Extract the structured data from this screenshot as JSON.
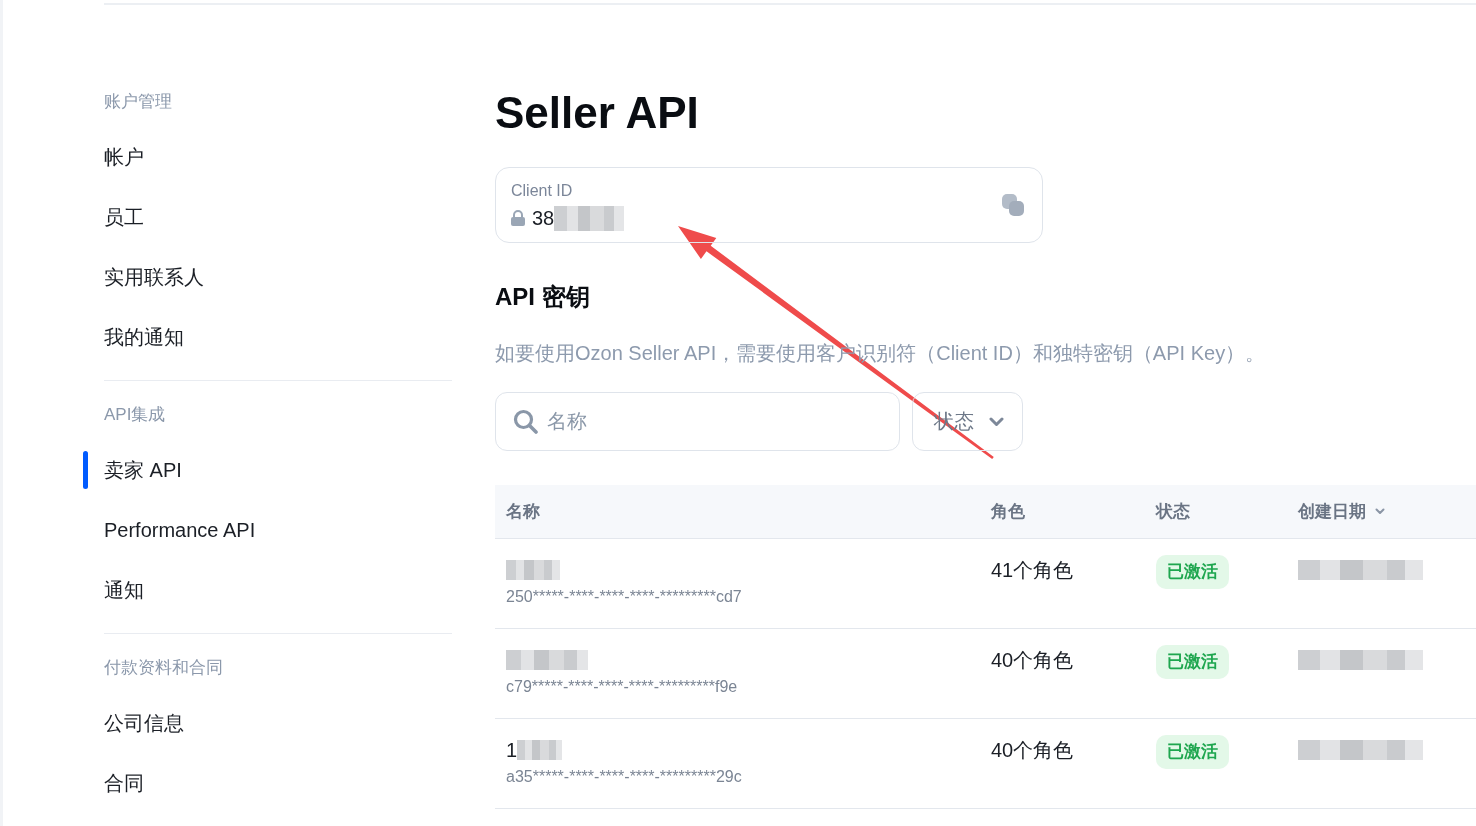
{
  "sidebar": {
    "sections": [
      {
        "title": "账户管理",
        "items": [
          {
            "label": "帐户",
            "selected": false
          },
          {
            "label": "员工",
            "selected": false
          },
          {
            "label": "实用联系人",
            "selected": false
          },
          {
            "label": "我的通知",
            "selected": false
          }
        ]
      },
      {
        "title": "API集成",
        "items": [
          {
            "label": "卖家 API",
            "selected": true
          },
          {
            "label": "Performance API",
            "selected": false
          },
          {
            "label": "通知",
            "selected": false
          }
        ]
      },
      {
        "title": "付款资料和合同",
        "items": [
          {
            "label": "公司信息",
            "selected": false
          },
          {
            "label": "合同",
            "selected": false
          }
        ]
      }
    ]
  },
  "page": {
    "title": "Seller API"
  },
  "client_id": {
    "label": "Client ID",
    "value": "38",
    "locked": true,
    "redacted": true
  },
  "api_keys": {
    "heading": "API 密钥",
    "description": "如要使用Ozon Seller API，需要使用客户识别符（Client ID）和独特密钥（API Key）。",
    "search": {
      "placeholder": "名称"
    },
    "status_filter": {
      "label": "状态"
    },
    "table": {
      "columns": [
        {
          "label": "名称",
          "sorted": false
        },
        {
          "label": "角色",
          "sorted": false
        },
        {
          "label": "状态",
          "sorted": false
        },
        {
          "label": "创建日期",
          "sorted": true
        }
      ],
      "rows": [
        {
          "name_redacted": true,
          "key": "250*****-****-****-****-*********cd7",
          "roles": "41个角色",
          "status": "已激活",
          "date_redacted": true
        },
        {
          "name_redacted": true,
          "key": "c79*****-****-****-****-*********f9e",
          "roles": "40个角色",
          "status": "已激活",
          "date_redacted": true
        },
        {
          "name": "1",
          "name_redacted": true,
          "key": "a35*****-****-****-****-*********29c",
          "roles": "40个角色",
          "status": "已激活",
          "date_redacted": true
        }
      ]
    }
  }
}
